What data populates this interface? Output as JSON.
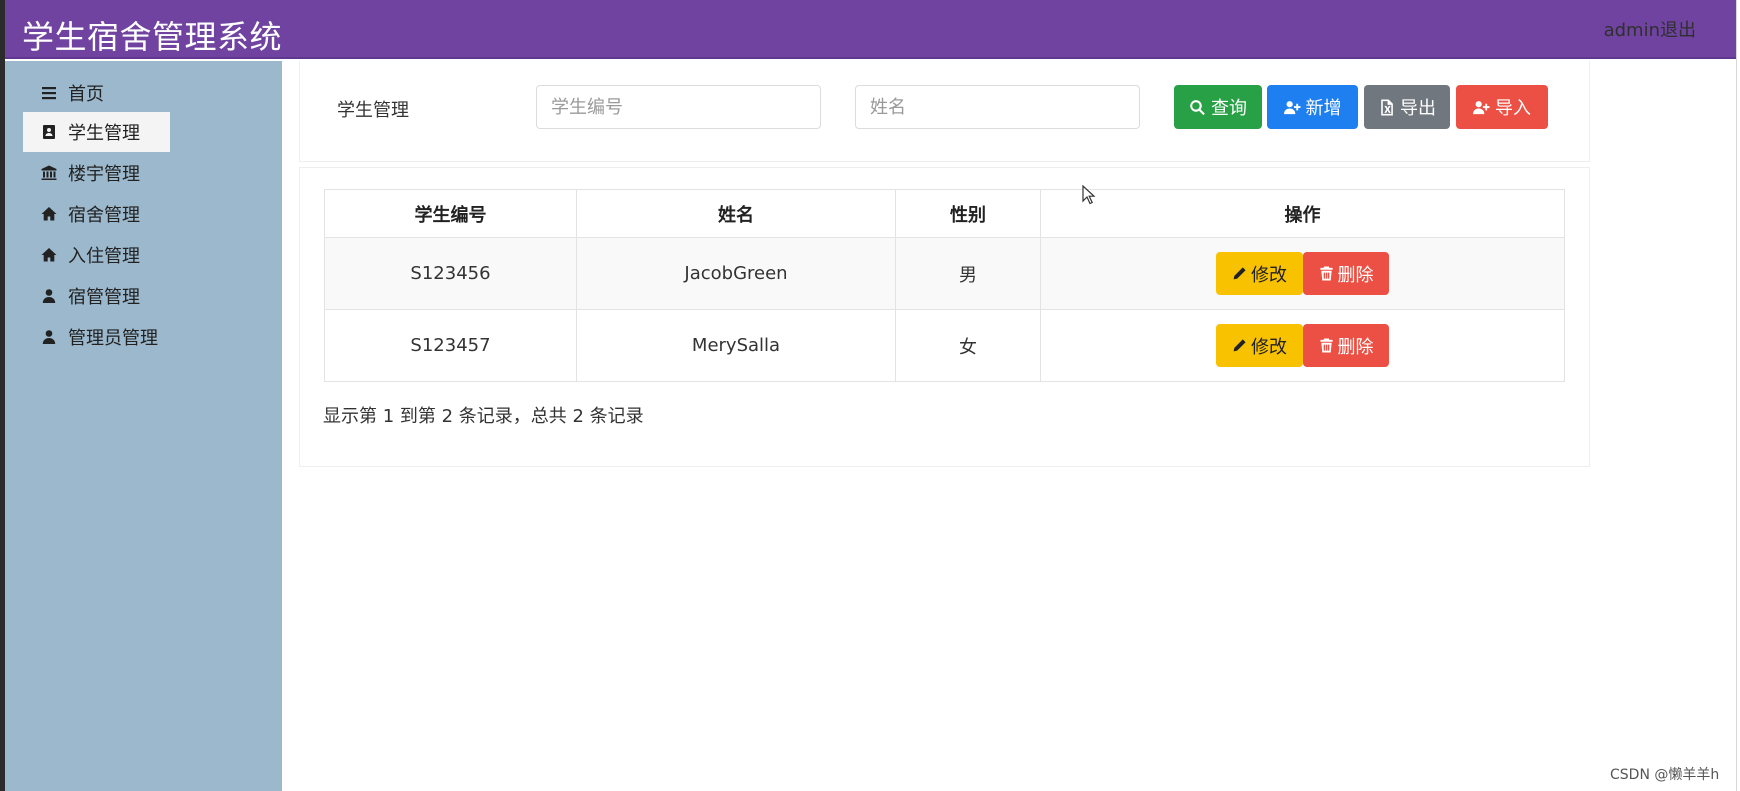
{
  "header": {
    "title": "学生宿舍管理系统",
    "user": "admin退出"
  },
  "sidebar": {
    "items": [
      {
        "label": "首页",
        "icon": "bars-icon"
      },
      {
        "label": "学生管理",
        "icon": "id-card-icon",
        "active": true
      },
      {
        "label": "楼宇管理",
        "icon": "bank-icon"
      },
      {
        "label": "宿舍管理",
        "icon": "home-icon"
      },
      {
        "label": "入住管理",
        "icon": "home-icon"
      },
      {
        "label": "宿管管理",
        "icon": "user-icon"
      },
      {
        "label": "管理员管理",
        "icon": "user-icon"
      }
    ]
  },
  "search": {
    "label": "学生管理",
    "student_no_placeholder": "学生编号",
    "name_placeholder": "姓名",
    "buttons": {
      "query": "查询",
      "add": "新增",
      "export": "导出",
      "import": "导入"
    }
  },
  "colors": {
    "header": "#7043a1",
    "sidebar": "#9bb8cc",
    "query": "#28a046",
    "add": "#1e7ff0",
    "export": "#70777e",
    "import": "#ec4f44",
    "edit": "#f8c200",
    "delete": "#ec4f44"
  },
  "table": {
    "columns": [
      "学生编号",
      "姓名",
      "性别",
      "操作"
    ],
    "rows": [
      {
        "student_no": "S123456",
        "name": "JacobGreen",
        "gender": "男"
      },
      {
        "student_no": "S123457",
        "name": "MerySalla",
        "gender": "女"
      }
    ],
    "edit_label": "修改",
    "delete_label": "删除"
  },
  "pagination": {
    "info": "显示第 1 到第 2 条记录，总共 2 条记录"
  },
  "watermark": "CSDN @懒羊羊h"
}
